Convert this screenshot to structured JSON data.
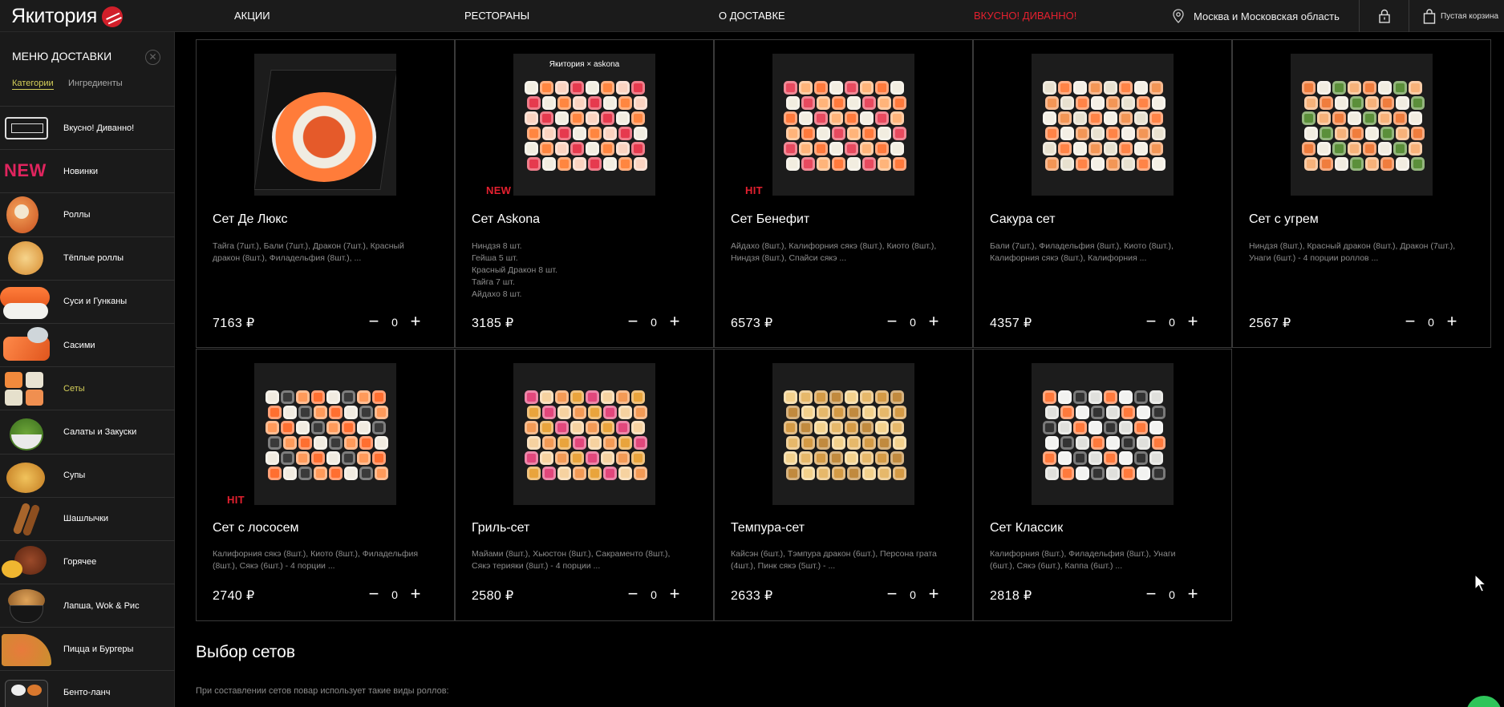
{
  "header": {
    "logo_text": "Якитория",
    "nav": [
      "АКЦИИ",
      "РЕСТОРАНЫ",
      "О ДОСТАВКЕ",
      "ВКУСНО! ДИВАННО!"
    ],
    "region": "Москва и Московская область",
    "cart_label": "Пустая корзина",
    "accent_color": "#e4202f"
  },
  "sidebar": {
    "title": "МЕНЮ ДОСТАВКИ",
    "close_icon": "close-icon",
    "tabs": [
      "Категории",
      "Ингредиенты"
    ],
    "items": [
      {
        "label": "Вкусно! Диванно!",
        "icon": "sofa-icon"
      },
      {
        "label": "Новинки",
        "thumb_text": "NEW"
      },
      {
        "label": "Роллы"
      },
      {
        "label": "Тёплые роллы"
      },
      {
        "label": "Суси и Гунканы"
      },
      {
        "label": "Сасими"
      },
      {
        "label": "Сеты",
        "active": true
      },
      {
        "label": "Салаты и Закуски"
      },
      {
        "label": "Супы"
      },
      {
        "label": "Шашлычки"
      },
      {
        "label": "Горячее"
      },
      {
        "label": "Лапша, Wok & Рис"
      },
      {
        "label": "Пицца и Бургеры"
      },
      {
        "label": "Бенто-ланч"
      }
    ]
  },
  "products": [
    {
      "title": "Сет Де Люкс",
      "desc": "Тайга (7шт.), Бали (7шт.), Дракон (7шт.), Красный дракон (8шт.), Филадельфия (8шт.), ...",
      "price": "7163 ₽",
      "qty": "0",
      "badge": ""
    },
    {
      "title": "Сет Askona",
      "desc_lines": [
        "Ниндзя 8 шт.",
        "Гейша 5 шт.",
        "Красный Дракон 8 шт.",
        "Тайга 7 шт.",
        "Айдахо 8 шт."
      ],
      "price": "3185 ₽",
      "qty": "0",
      "badge": "NEW",
      "img_caption": "Якитория × askona"
    },
    {
      "title": "Сет Бенефит",
      "desc": "Айдахо (8шт.), Калифорния сякэ (8шт.), Киото (8шт.), Ниндзя (8шт.), Спайси сякэ ...",
      "price": "6573 ₽",
      "qty": "0",
      "badge": "HIT"
    },
    {
      "title": "Сакура сет",
      "desc": "Бали (7шт.), Филадельфия (8шт.), Киото (8шт.), Калифорния сякэ (8шт.), Калифорния ...",
      "price": "4357 ₽",
      "qty": "0",
      "badge": ""
    },
    {
      "title": "Сет с угрем",
      "desc": "Ниндзя (8шт.), Красный дракон (8шт.), Дракон (7шт.), Унаги (6шт.) - 4 порции роллов ...",
      "price": "2567 ₽",
      "qty": "0",
      "badge": ""
    },
    {
      "title": "Сет с лососем",
      "desc": "Калифорния сякэ (8шт.), Киото (8шт.), Филадельфия (8шт.), Сякэ (6шт.) - 4 порции ...",
      "price": "2740 ₽",
      "qty": "0",
      "badge": "HIT"
    },
    {
      "title": "Гриль-сет",
      "desc": "Майами (8шт.), Хьюстон (8шт.), Сакраменто (8шт.), Сякэ терияки (8шт.) - 4 порции ...",
      "price": "2580 ₽",
      "qty": "0",
      "badge": ""
    },
    {
      "title": "Темпура-сет",
      "desc": "Кайсэн (6шт.), Тэмпура дракон (6шт.), Персона грата (4шт.), Пинк сякэ (5шт.) - ...",
      "price": "2633 ₽",
      "qty": "0",
      "badge": ""
    },
    {
      "title": "Сет Классик",
      "desc": "Калифорния (8шт.), Филадельфия (8шт.), Унаги (6шт.), Сякэ (6шт.), Каппа (6шт.) ...",
      "price": "2818 ₽",
      "qty": "0",
      "badge": ""
    }
  ],
  "qty_controls": {
    "minus": "−",
    "plus": "+"
  },
  "section": {
    "title": "Выбор сетов",
    "text": "При составлении сетов повар использует такие виды роллов:"
  }
}
